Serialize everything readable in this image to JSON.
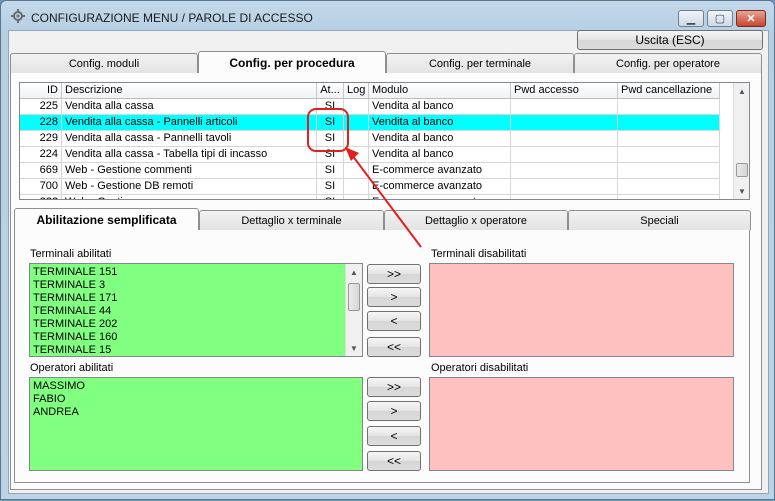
{
  "window": {
    "title": "CONFIGURAZIONE MENU / PAROLE DI ACCESSO",
    "min_glyph": "▁",
    "max_glyph": "▢",
    "close_glyph": "✕"
  },
  "toolbar": {
    "exit_label": "Uscita (ESC)"
  },
  "main_tabs": [
    {
      "label": "Config. moduli",
      "active": false
    },
    {
      "label": "Config. per procedura",
      "active": true
    },
    {
      "label": "Config. per terminale",
      "active": false
    },
    {
      "label": "Config. per operatore",
      "active": false
    }
  ],
  "grid": {
    "columns": [
      "ID",
      "Descrizione",
      "At...",
      "Log",
      "Modulo",
      "Pwd accesso",
      "Pwd cancellazione"
    ],
    "rows": [
      [
        "225",
        "Vendita alla cassa",
        "SI",
        "",
        "Vendita al banco",
        "",
        ""
      ],
      [
        "228",
        "Vendita alla cassa - Pannelli articoli",
        "SI",
        "",
        "Vendita al banco",
        "",
        ""
      ],
      [
        "229",
        "Vendita alla cassa - Pannelli tavoli",
        "SI",
        "",
        "Vendita al banco",
        "",
        ""
      ],
      [
        "224",
        "Vendita alla cassa - Tabella tipi di incasso",
        "SI",
        "",
        "Vendita al banco",
        "",
        ""
      ],
      [
        "669",
        "Web - Gestione commenti",
        "SI",
        "",
        "E-commerce avanzato",
        "",
        ""
      ],
      [
        "700",
        "Web - Gestione DB remoti",
        "SI",
        "",
        "E-commerce avanzato",
        "",
        ""
      ],
      [
        "???",
        "Web - Gestione...",
        "SI",
        "",
        "E-commerce avanzato",
        "",
        ""
      ]
    ],
    "selected_row": 1
  },
  "sub_tabs": [
    {
      "label": "Abilitazione semplificata",
      "active": true
    },
    {
      "label": "Dettaglio x terminale",
      "active": false
    },
    {
      "label": "Dettaglio x operatore",
      "active": false
    },
    {
      "label": "Speciali",
      "active": false
    }
  ],
  "terminals": {
    "enabled_label": "Terminali abilitati",
    "disabled_label": "Terminali disabilitati",
    "enabled": [
      "TERMINALE 151",
      "TERMINALE 3",
      "TERMINALE 171",
      "TERMINALE 44",
      "TERMINALE 202",
      "TERMINALE 160",
      "TERMINALE 15"
    ],
    "disabled": []
  },
  "operators": {
    "enabled_label": "Operatori abilitati",
    "disabled_label": "Operatori disabilitati",
    "enabled": [
      "MASSIMO",
      "FABIO",
      "ANDREA"
    ],
    "disabled": []
  },
  "transfer_buttons": {
    "all_right": ">>",
    "one_right": ">",
    "one_left": "<",
    "all_left": "<<"
  },
  "colors": {
    "selected_row": "#00ffff",
    "enabled_list": "#80ff80",
    "disabled_list": "#ffc0c0",
    "annotation": "#e02020"
  },
  "icons": {
    "app": "gear-icon",
    "scroll_up": "arrow-up-icon",
    "scroll_down": "arrow-down-icon"
  }
}
